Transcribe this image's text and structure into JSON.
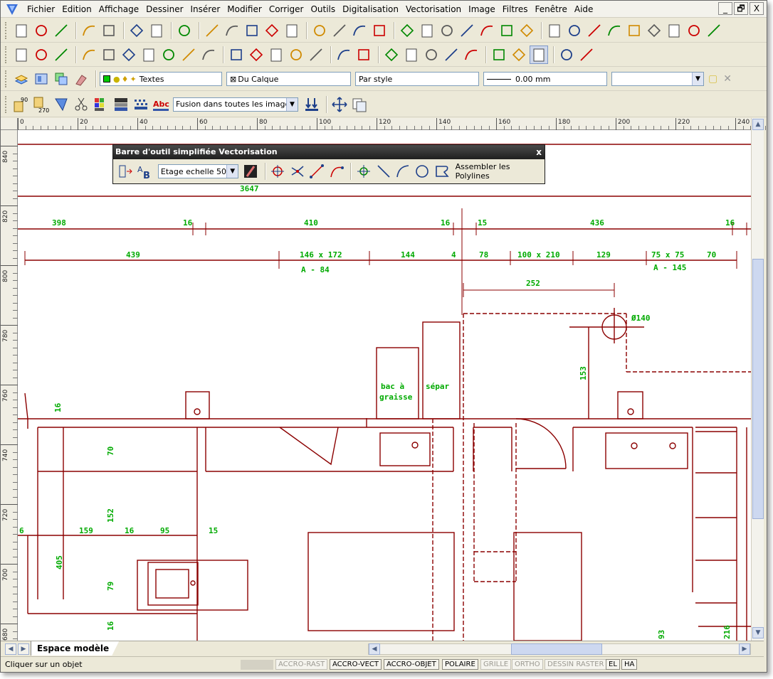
{
  "menu": [
    "Fichier",
    "Edition",
    "Affichage",
    "Dessiner",
    "Insérer",
    "Modifier",
    "Corriger",
    "Outils",
    "Digitalisation",
    "Vectorisation",
    "Image",
    "Filtres",
    "Fenêtre",
    "Aide"
  ],
  "window_buttons": {
    "minimize": "_",
    "restore": "🗗",
    "close": "X"
  },
  "toolbar1_icons": [
    "new-file-icon",
    "open-folder-icon",
    "save-icon",
    "print-preview-icon",
    "print-icon",
    "undo-icon",
    "redo-icon",
    "layers-icon",
    "zoom-in-icon",
    "zoom-out-icon",
    "zoom-1-1-icon",
    "zoom-window-icon",
    "zoom-extents-icon",
    "erase-pixels-icon",
    "cut-icon",
    "cloud-icon",
    "pan-hand-icon",
    "line-icon",
    "arc-icon",
    "circle-icon",
    "polygon-icon",
    "polyline-icon",
    "spline-icon",
    "ellipse-icon",
    "hatch-icon",
    "text-icon",
    "cross-point-icon",
    "image-insert-icon",
    "image-icon",
    "photo-icon",
    "photo-edit-icon",
    "pattern-icon",
    "dimension-icon"
  ],
  "toolbar2_icons": [
    "snap-point-icon",
    "snap-zoom-icon",
    "snap-zoom2-icon",
    "select-arrow-icon",
    "select-arc-icon",
    "select-circle-icon",
    "select-node-icon",
    "select-fill-icon",
    "select-knife-icon",
    "select-polygon-icon",
    "zoom-select-icon",
    "zoom-select2-icon",
    "zoom-select3-icon",
    "zoom-select4-icon",
    "zoom-select5-icon",
    "list-filter-icon",
    "funnel-filter-icon",
    "vector-edit-icon",
    "vector-node-icon",
    "vector-move-icon",
    "vector-grid-icon",
    "no-select-icon",
    "add-vertex-icon",
    "remove-vertex-icon",
    "bold-vertex-icon",
    "document-icon",
    "document-add-icon"
  ],
  "props_bar": {
    "layer": "Textes",
    "color": "Du Calque",
    "linetype": "Par style",
    "lineweight": "0.00 mm",
    "extra": ""
  },
  "toolbar4": {
    "rotate90_label": "90",
    "rotate270_label": "270",
    "merge_label": "Fusion dans toutes les images"
  },
  "floating_toolbar": {
    "title": "Barre d'outil simplifiée Vectorisation",
    "close": "x",
    "scale_option": "Etage echelle 50",
    "assemble_label": "Assembler les Polylines"
  },
  "ruler_h": [
    "0",
    "20",
    "40",
    "60",
    "80",
    "100",
    "120",
    "140",
    "160",
    "180",
    "200",
    "220",
    "240"
  ],
  "ruler_v": [
    "840",
    "820",
    "800",
    "780",
    "760",
    "740",
    "720",
    "700",
    "680"
  ],
  "drawing": {
    "dim_top": "3647",
    "dims_row1": [
      "398",
      "16",
      "410",
      "16",
      "15",
      "436",
      "16"
    ],
    "dims_row2": [
      "439",
      "146 x 172",
      "144",
      "4",
      "78",
      "100 x 210",
      "129",
      "75 x 75",
      "70"
    ],
    "area1": "A - 84",
    "area2": "A - 145",
    "dim_252": "252",
    "dim_diam": "Ø140",
    "dim_153": "153",
    "label_bac": "bac  à",
    "label_graisse": "graisse",
    "label_separ": "sépar",
    "dims_left": [
      "16",
      "70",
      "152",
      "16",
      "159",
      "16",
      "95",
      "15",
      "405",
      "79",
      "16",
      "6"
    ],
    "dims_right": [
      "93",
      "216"
    ]
  },
  "tabs": {
    "model": "Espace modèle"
  },
  "status": {
    "message": "Cliquer sur un objet",
    "modes": [
      {
        "label": "ACCRO-RAST",
        "on": false
      },
      {
        "label": "ACCRO-VECT",
        "on": true
      },
      {
        "label": "ACCRO-OBJET",
        "on": true
      },
      {
        "label": "POLAIRE",
        "on": true
      },
      {
        "label": "GRILLE",
        "on": false
      },
      {
        "label": "ORTHO",
        "on": false
      },
      {
        "label": "DESSIN RASTER",
        "on": false
      },
      {
        "label": "EL",
        "on": true
      },
      {
        "label": "HA",
        "on": true
      }
    ]
  },
  "colors": {
    "drawing_line": "#8b0000",
    "dimension_text": "#00b000",
    "toolbar_bg": "#ece9d8"
  }
}
